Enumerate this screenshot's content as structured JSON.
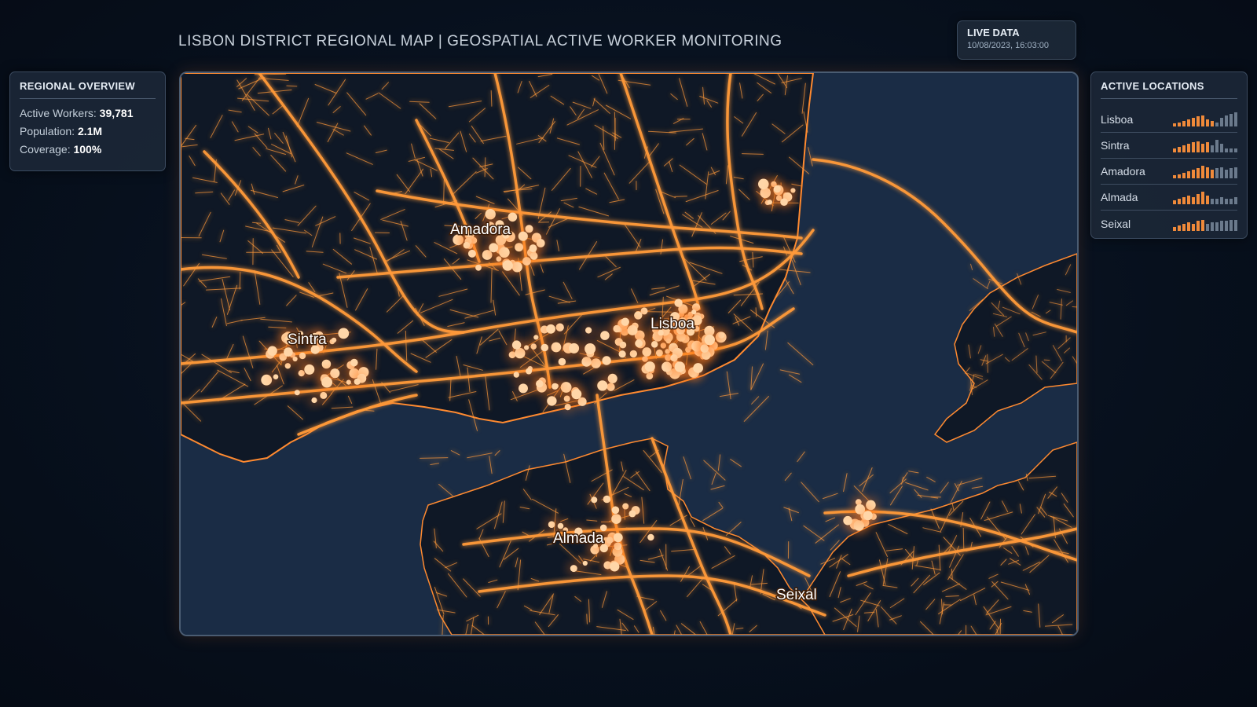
{
  "header": {
    "title": "LISBON DISTRICT REGIONAL MAP | GEOSPATIAL ACTIVE WORKER MONITORING"
  },
  "live": {
    "label": "LIVE DATA",
    "timestamp": "10/08/2023, 16:03:00"
  },
  "overview": {
    "title": "REGIONAL OVERVIEW",
    "stats": [
      {
        "label": "Active Workers:",
        "value": "39,781"
      },
      {
        "label": "Population:",
        "value": "2.1M"
      },
      {
        "label": "Coverage:",
        "value": "100%"
      }
    ]
  },
  "locations": {
    "title": "ACTIVE LOCATIONS",
    "items": [
      {
        "name": "Lisboa",
        "activity": [
          0.2,
          0.3,
          0.4,
          0.5,
          0.6,
          0.7,
          0.8,
          0.5,
          0.4,
          0.3,
          0.6,
          0.8,
          0.9,
          1.0
        ],
        "active_bars": 9
      },
      {
        "name": "Sintra",
        "activity": [
          0.3,
          0.4,
          0.5,
          0.6,
          0.7,
          0.8,
          0.6,
          0.7,
          0.5,
          0.9,
          0.6,
          0.3,
          0.3,
          0.3
        ],
        "active_bars": 8
      },
      {
        "name": "Amadora",
        "activity": [
          0.2,
          0.3,
          0.4,
          0.5,
          0.6,
          0.7,
          0.9,
          0.8,
          0.6,
          0.7,
          0.8,
          0.6,
          0.7,
          0.8
        ],
        "active_bars": 9
      },
      {
        "name": "Almada",
        "activity": [
          0.3,
          0.4,
          0.5,
          0.6,
          0.5,
          0.7,
          0.9,
          0.6,
          0.4,
          0.4,
          0.5,
          0.4,
          0.4,
          0.5
        ],
        "active_bars": 8
      },
      {
        "name": "Seixal",
        "activity": [
          0.3,
          0.4,
          0.5,
          0.6,
          0.5,
          0.7,
          0.8,
          0.5,
          0.6,
          0.6,
          0.7,
          0.7,
          0.8,
          0.8
        ],
        "active_bars": 7
      }
    ]
  },
  "map": {
    "labels": [
      "Amadora",
      "Lisboa",
      "Sintra",
      "Almada",
      "Seixal"
    ],
    "colors": {
      "water": "#1a2c45",
      "land": "#101a28",
      "road": "#ff9a3a",
      "road_glow": "#ff6a10",
      "marker": "#ffd6a8",
      "bar_active": "#f08a3a",
      "bar_inactive": "#6b7a8c"
    }
  }
}
